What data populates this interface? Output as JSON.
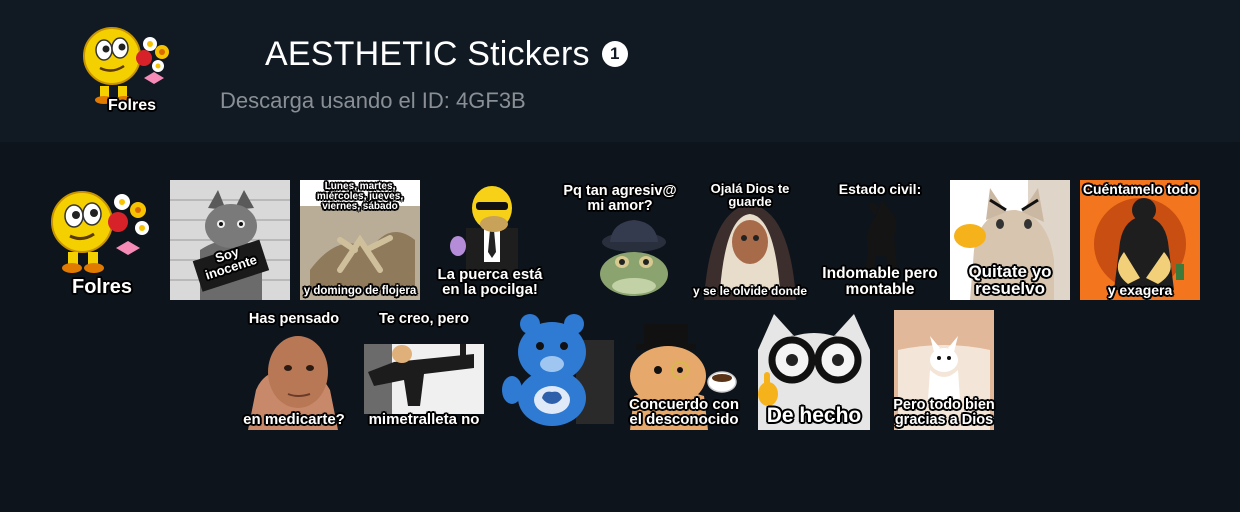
{
  "header": {
    "title": "AESTHETIC Stickers",
    "badge_count": "1",
    "subtitle_prefix": "Descarga usando el ID: ",
    "sticker_id": "4GF3B",
    "thumbnail_caption": "Folres"
  },
  "stickers": [
    {
      "top": "",
      "bottom": "Folres"
    },
    {
      "top": "",
      "bottom": "",
      "mid": "Soy inocente"
    },
    {
      "top": "Lunes, martes, miércoles, jueves, viernes, sábado",
      "bottom": "y domingo de flojera"
    },
    {
      "top": "",
      "bottom": "La puerca está en la pocilga!"
    },
    {
      "top": "Pq tan agresiv@ mi amor?",
      "bottom": ""
    },
    {
      "top": "Ojalá Dios te guarde",
      "bottom": "y se le olvide donde"
    },
    {
      "top": "Estado civil:",
      "bottom": "Indomable pero montable"
    },
    {
      "top": "",
      "bottom": "Quitate yo resuelvo"
    },
    {
      "top": "Cuéntamelo todo",
      "bottom": "y exagera"
    },
    {
      "top": "Has pensado",
      "bottom": "en medicarte?"
    },
    {
      "top": "Te creo, pero",
      "bottom": "mimetralleta no"
    },
    {
      "top": "",
      "bottom": ""
    },
    {
      "top": "",
      "bottom": "Concuerdo con el desconocido"
    },
    {
      "top": "",
      "bottom": "De hecho"
    },
    {
      "top": "",
      "bottom": "Pero todo bien gracias a Dios"
    }
  ]
}
